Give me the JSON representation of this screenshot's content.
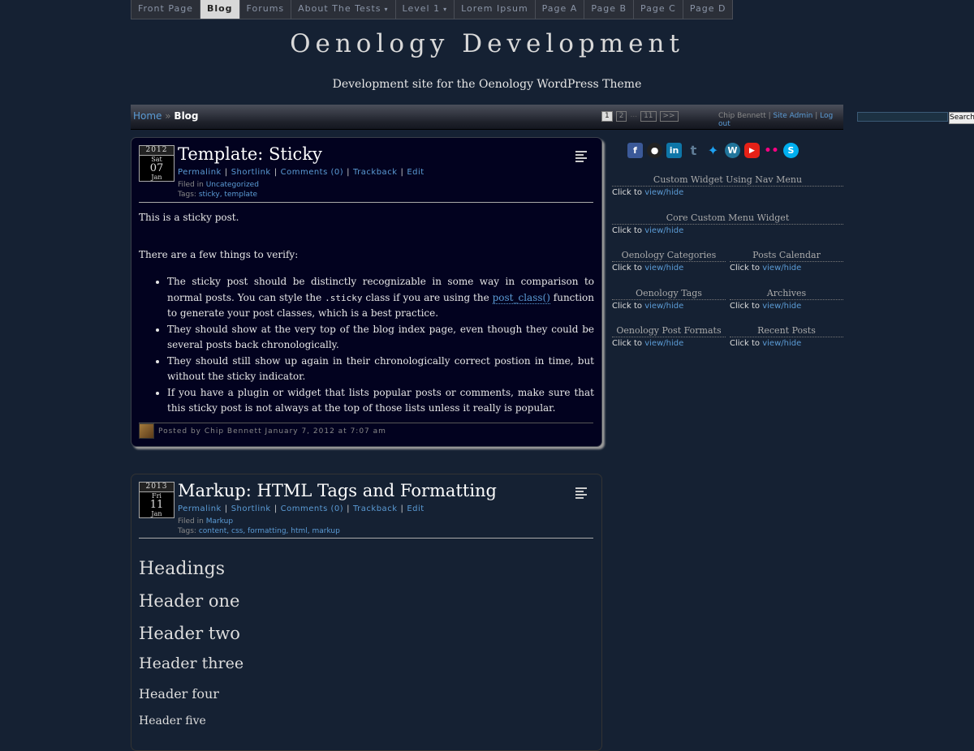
{
  "nav": {
    "items": [
      {
        "label": "Front Page"
      },
      {
        "label": "Blog"
      },
      {
        "label": "Forums"
      },
      {
        "label": "About The Tests",
        "caret": "▾"
      },
      {
        "label": "Level 1",
        "caret": "▾"
      },
      {
        "label": "Lorem Ipsum"
      },
      {
        "label": "Page A"
      },
      {
        "label": "Page B"
      },
      {
        "label": "Page C"
      },
      {
        "label": "Page D"
      }
    ]
  },
  "site": {
    "title": "Oenology Development",
    "description": "Development site for the Oenology WordPress Theme"
  },
  "breadcrumb": {
    "home": "Home",
    "sep": " » ",
    "current": "Blog"
  },
  "pager": {
    "pages": [
      "1",
      "2"
    ],
    "dots": "...",
    "last": "11",
    "next": ">>"
  },
  "userlinks": {
    "user": "Chip Bennett",
    "sep": " | ",
    "admin": "Site Admin",
    "logout": "Log out"
  },
  "search": {
    "button": "Search",
    "value": ""
  },
  "posts": [
    {
      "date": {
        "year": "2012",
        "dow": "Sat",
        "day": "07",
        "month": "Jan"
      },
      "title": "Template: Sticky",
      "meta": [
        "Permalink",
        "Shortlink",
        "Comments (0)",
        "Trackback",
        "Edit"
      ],
      "filed_prefix": "Filed in ",
      "category": "Uncategorized",
      "tags_prefix": "Tags: ",
      "tags": "sticky, template",
      "body": {
        "p1": "This is a sticky post.",
        "p2": "There are a few things to verify:",
        "li1a": "The sticky post should be distinctly recognizable in some way in comparison to normal posts. You can style the ",
        "li1code": ".sticky",
        "li1b": " class if you are using the ",
        "li1fn": "post_class()",
        "li1c": " function to generate your post classes, which is a best practice.",
        "li2": "They should show at the very top of the blog index page, even though they could be several posts back chronologically.",
        "li3": "They should still show up again in their chronologically correct postion in time, but without the sticky indicator.",
        "li4": "If you have a plugin or widget that lists popular posts or comments, make sure that this sticky post is not always at the top of those lists unless it really is popular."
      },
      "byline": "Posted by Chip Bennett January 7, 2012 at 7:07 am"
    },
    {
      "date": {
        "year": "2013",
        "dow": "Fri",
        "day": "11",
        "month": "Jan"
      },
      "title": "Markup: HTML Tags and Formatting",
      "meta": [
        "Permalink",
        "Shortlink",
        "Comments (0)",
        "Trackback",
        "Edit"
      ],
      "filed_prefix": "Filed in ",
      "category": "Markup",
      "tags_prefix": "Tags: ",
      "tags": "content, css, formatting, html, markup",
      "headings": [
        "Headings",
        "Header one",
        "Header two",
        "Header three",
        "Header four",
        "Header five"
      ]
    }
  ],
  "social": [
    {
      "icon": "facebook-icon",
      "glyph": "f",
      "color": "#3b5998"
    },
    {
      "icon": "github-icon",
      "glyph": "●",
      "color": "#222222"
    },
    {
      "icon": "linkedin-icon",
      "glyph": "in",
      "color": "#0e76a8"
    },
    {
      "icon": "tumblr-icon",
      "glyph": "t",
      "color": "#5f7c96"
    },
    {
      "icon": "twitter-icon",
      "glyph": "✦",
      "color": "#1da1f2"
    },
    {
      "icon": "wordpress-icon",
      "glyph": "W",
      "color": "#21759b"
    },
    {
      "icon": "youtube-icon",
      "glyph": "▶",
      "color": "#e62117"
    },
    {
      "icon": "flickr-icon",
      "glyph": "••",
      "color": "#ff0084"
    },
    {
      "icon": "skype-icon",
      "glyph": "S",
      "color": "#00aff0"
    }
  ],
  "widgets": {
    "click_prefix": "Click to ",
    "click_link": "view/hide",
    "items": [
      {
        "title": "Custom Widget Using Nav Menu"
      },
      {
        "title": "Core Custom Menu Widget"
      },
      {
        "title": "Oenology Categories"
      },
      {
        "title": "Posts Calendar"
      },
      {
        "title": "Oenology Tags"
      },
      {
        "title": "Archives"
      },
      {
        "title": "Oenology Post Formats"
      },
      {
        "title": "Recent Posts"
      }
    ]
  }
}
